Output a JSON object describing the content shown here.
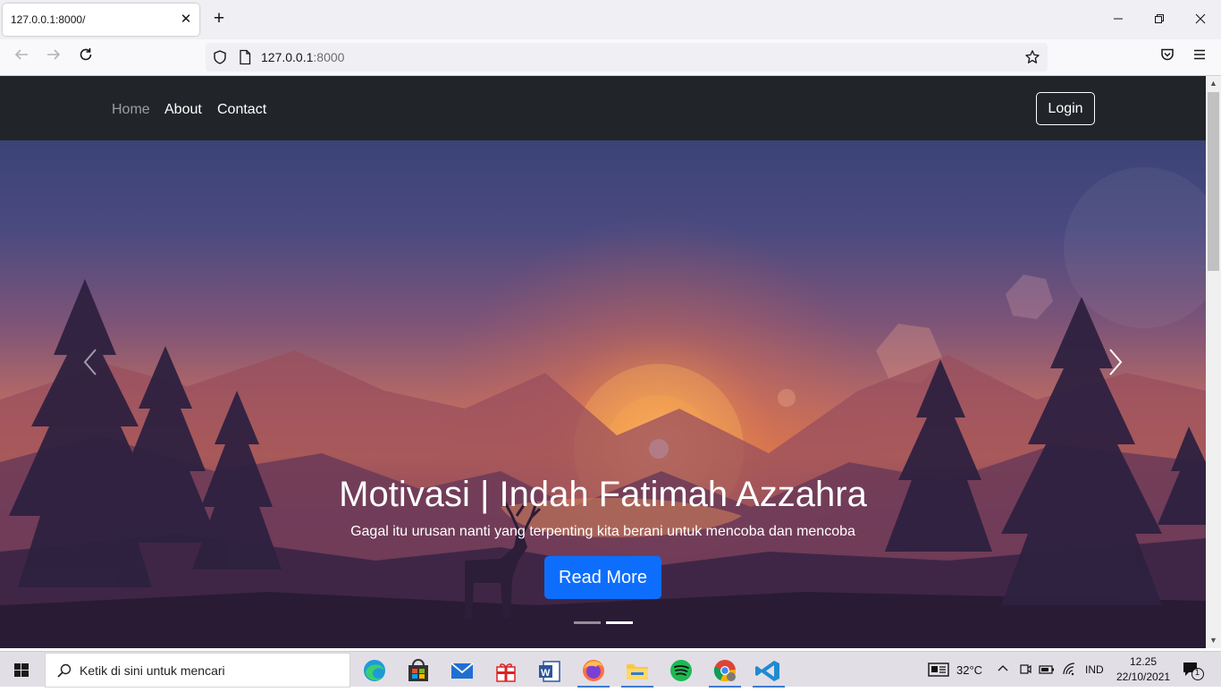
{
  "browser": {
    "tab_title": "127.0.0.1:8000/",
    "tab_close": "✕",
    "new_tab": "+",
    "url_host": "127.0.0.1",
    "url_port": ":8000",
    "window_minimize": "—",
    "window_restore": "❐",
    "window_close": "✕"
  },
  "site": {
    "nav": {
      "links": [
        "Home",
        "About",
        "Contact"
      ],
      "active": "Home",
      "login_label": "Login"
    },
    "hero": {
      "title": "Motivasi | Indah Fatimah Azzahra",
      "subtitle": "Gagal itu urusan nanti yang terpenting kita berani untuk mencoba dan mencoba",
      "button_label": "Read More",
      "slides": 2,
      "active_slide": 2
    }
  },
  "taskbar": {
    "search_placeholder": "Ketik di sini untuk mencari",
    "weather": "32°C",
    "language": "IND",
    "time": "12.25",
    "date": "22/10/2021",
    "notification_count": "1",
    "apps": [
      "edge-icon",
      "store-icon",
      "mail-icon",
      "gift-icon",
      "word-icon",
      "firefox-icon",
      "file-explorer-icon",
      "spotify-icon",
      "chrome-icon",
      "vscode-icon"
    ]
  },
  "colors": {
    "site_nav_bg": "#212529",
    "primary_button": "#0d6efd"
  }
}
